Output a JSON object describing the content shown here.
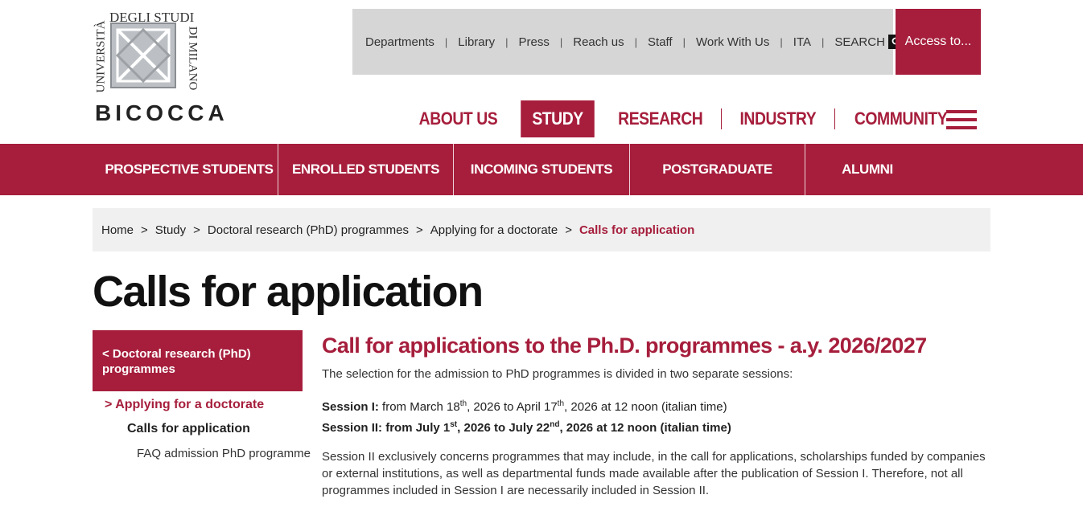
{
  "logo": {
    "line1": "UNIVERSITÀ",
    "line2": "DEGLI STUDI",
    "line3": "DI MILANO",
    "line4": "BICOCCA"
  },
  "utility_nav": [
    "Departments",
    "Library",
    "Press",
    "Reach us",
    "Staff",
    "Work With Us",
    "ITA"
  ],
  "search_label": "SEARCH",
  "access_label": "Access to...",
  "main_nav": [
    {
      "label": "ABOUT US",
      "active": false
    },
    {
      "label": "STUDY",
      "active": true
    },
    {
      "label": "RESEARCH",
      "active": false
    },
    {
      "label": "INDUSTRY",
      "active": false
    },
    {
      "label": "COMMUNITY",
      "active": false
    }
  ],
  "sub_nav": [
    "PROSPECTIVE STUDENTS",
    "ENROLLED STUDENTS",
    "INCOMING STUDENTS",
    "POSTGRADUATE",
    "ALUMNI"
  ],
  "breadcrumb": [
    "Home",
    "Study",
    "Doctoral research (PhD) programmes",
    "Applying for a doctorate",
    "Calls for application"
  ],
  "page_title": "Calls for application",
  "sidebar": {
    "back_label": "< Doctoral research (PhD) programmes",
    "item1": "> Applying for a doctorate",
    "item2": "Calls for application",
    "item3": "FAQ admission PhD programme"
  },
  "content": {
    "heading": "Call for applications to the Ph.D. programmes - a.y. 2026/2027",
    "intro": "The selection for the admission to PhD programmes is divided in two separate sessions:",
    "session1_label": "Session I:",
    "session1_a": " from March 18",
    "session1_b": ", 2026 to April 17",
    "session1_c": ", 2026  at 12 noon (italian time)",
    "session2_label": "Session II:",
    "session2_a": " from July 1",
    "session2_b": ", 2026 to July 22",
    "session2_c": ", 2026 at 12 noon (italian time)",
    "sup_th": "th",
    "sup_st": "st",
    "sup_nd": "nd",
    "para2": "Session II exclusively concerns programmes that may include, in the call for applications, scholarships funded by companies or external institutions, as well as departmental funds made available after the publication of Session I. Therefore, not all programmes included in Session I are necessarily included in Session II."
  },
  "colors": {
    "brand": "#a61e3c",
    "utility_bg": "#d6d6d6",
    "crumb_bg": "#f0f0f0"
  }
}
